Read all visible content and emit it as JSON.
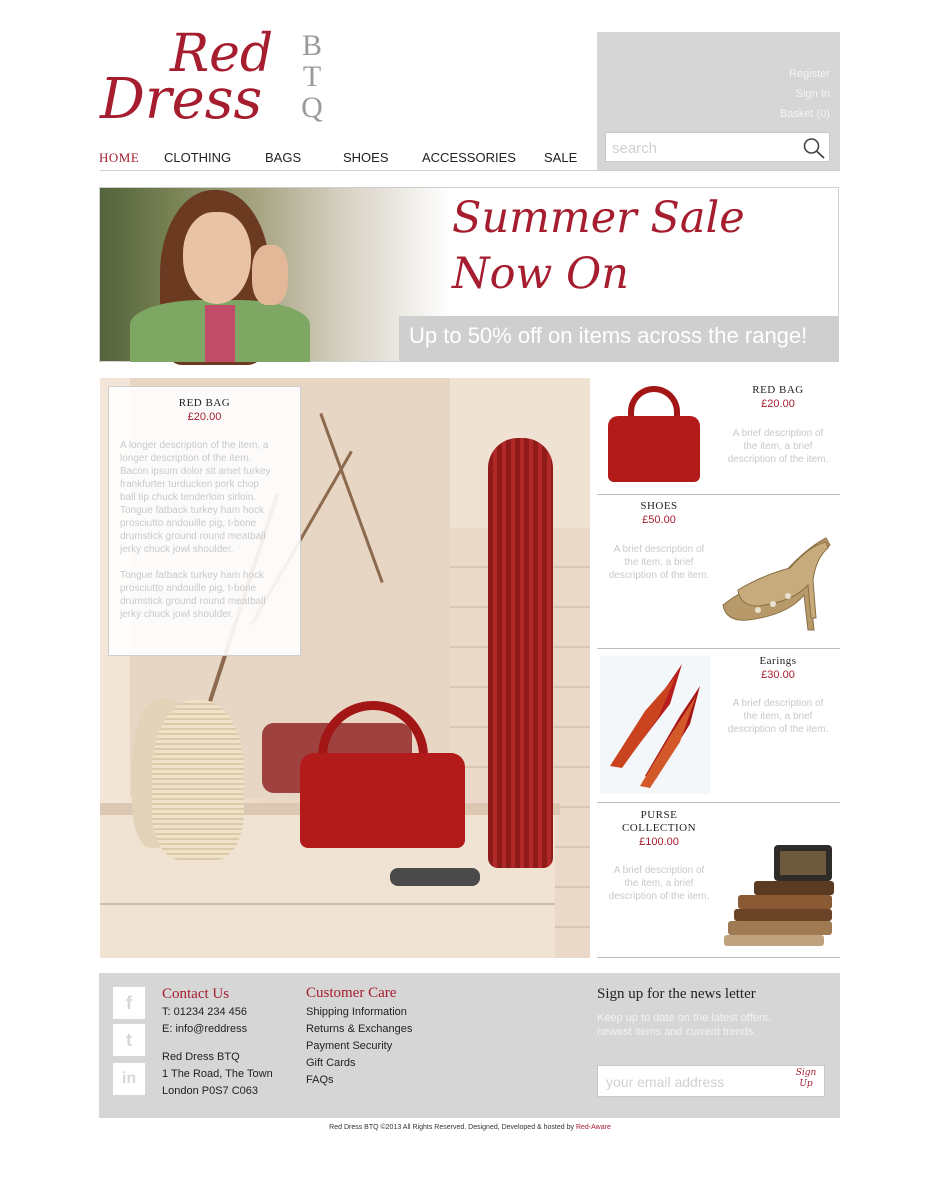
{
  "logo": {
    "line1": "Red",
    "line2": "Dress",
    "btq": [
      "B",
      "T",
      "Q"
    ]
  },
  "nav": [
    {
      "label": "HOME"
    },
    {
      "label": "CLOTHING"
    },
    {
      "label": "BAGS"
    },
    {
      "label": "SHOES"
    },
    {
      "label": "ACCESSORIES"
    },
    {
      "label": "SALE"
    }
  ],
  "account": {
    "register": "Register",
    "sign_in": "Sign In",
    "basket": "Basket (0)"
  },
  "search": {
    "placeholder": "search"
  },
  "banner": {
    "title_line1": "Summer Sale",
    "title_line2": "Now On",
    "subtitle": "Up to 50% off on items across the range!"
  },
  "feature": {
    "title": "RED BAG",
    "price": "£20.00",
    "desc_lines_1": [
      "A longer description of the item, a",
      "longer description of the item.",
      "Bacon ipsum dolor sit amet turkey",
      "frankfurter turducken pork chop",
      "ball tip chuck tenderloin sirloin.",
      "Tongue fatback turkey ham hock",
      "prosciutto andouille pig, t-bone",
      "drumstick ground round meatball",
      "jerky chuck jowl shoulder."
    ],
    "desc_lines_2": [
      "Tongue fatback turkey ham hock",
      "prosciutto andouille pig, t-bone",
      "drumstick ground round meatball",
      "jerky chuck jowl shoulder."
    ]
  },
  "products": [
    {
      "title": "RED BAG",
      "price": "£20.00",
      "desc_lines": [
        "A brief description of",
        "the item, a brief",
        "description of the item."
      ]
    },
    {
      "title": "SHOES",
      "price": "£50.00",
      "desc_lines": [
        "A brief description of",
        "the item, a brief",
        "description of the item."
      ]
    },
    {
      "title": "Earings",
      "price": "£30.00",
      "desc_lines": [
        "A brief description of",
        "the item, a brief",
        "description of the item."
      ]
    },
    {
      "title_lines": [
        "PURSE",
        "COLLECTION"
      ],
      "price": "£100.00",
      "desc_lines": [
        "A brief description of",
        "the item, a brief",
        "description of the item."
      ]
    }
  ],
  "footer": {
    "social": [
      {
        "icon": "facebook-icon",
        "glyph": "f"
      },
      {
        "icon": "twitter-icon",
        "glyph": "t"
      },
      {
        "icon": "linkedin-icon",
        "glyph": "in"
      }
    ],
    "contact": {
      "heading": "Contact Us",
      "phone": "T: 01234 234 456",
      "email": "E: info@reddress",
      "address": [
        "Red Dress BTQ",
        "1 The Road, The Town",
        "London P0S7 C063"
      ]
    },
    "customer_care": {
      "heading": "Customer Care",
      "links": [
        "Shipping Information",
        "Returns & Exchanges",
        "Payment Security",
        "Gift Cards",
        "FAQs"
      ]
    },
    "newsletter": {
      "heading": "Sign up for the news letter",
      "desc_lines": [
        "Keep up to date on the latest offers,",
        "newest items and current trends."
      ],
      "placeholder": "your email address",
      "button_lines": [
        "Sign",
        "Up"
      ]
    }
  },
  "copyright": {
    "text": "Red Dress BTQ ©2013 All Rights Reserved. Designed, Developed & hosted by ",
    "link": "Red-Aware"
  },
  "colors": {
    "brand_red": "#a51d2e",
    "panel_grey": "#d6d6d6"
  }
}
